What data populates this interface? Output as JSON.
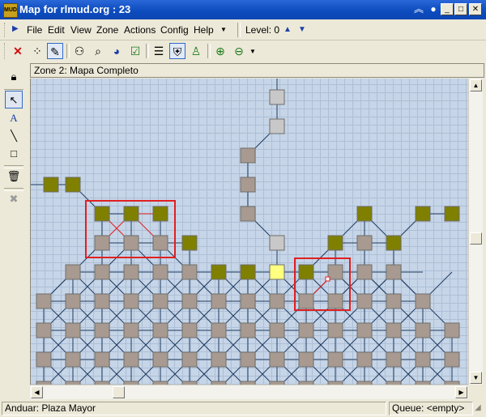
{
  "window": {
    "title": "Map for rlmud.org : 23",
    "app_icon": "mud-app-icon"
  },
  "menu": {
    "items": [
      "File",
      "Edit",
      "View",
      "Zone",
      "Actions",
      "Config",
      "Help"
    ],
    "level_label": "Level: 0"
  },
  "toolbar": {
    "icons": [
      "delete-icon",
      "path-dots-icon",
      "auto-map-icon",
      "binoculars-icon",
      "find-icon",
      "globe-icon",
      "checkbox-icon",
      "walk-list-icon",
      "shield-person-icon",
      "person-walk-icon",
      "zoom-in-icon",
      "zoom-out-icon"
    ]
  },
  "tools": {
    "icons": [
      "lock-icon",
      "pointer-icon",
      "text-tool-icon",
      "line-tool-icon",
      "rect-tool-icon",
      "trash-icon",
      "remove-icon"
    ],
    "text_glyph": "A"
  },
  "zone": {
    "label": "Zone 2: Mapa Completo"
  },
  "status": {
    "location": "Anduar: Plaza Mayor",
    "queue": "Queue: <empty>"
  },
  "colors": {
    "room": "#a89a90",
    "room_olive": "#7f7f00",
    "room_current": "#ffff80",
    "room_gray": "#c8c8c8",
    "link": "#1e3a5f",
    "highlight": "#e02020"
  }
}
